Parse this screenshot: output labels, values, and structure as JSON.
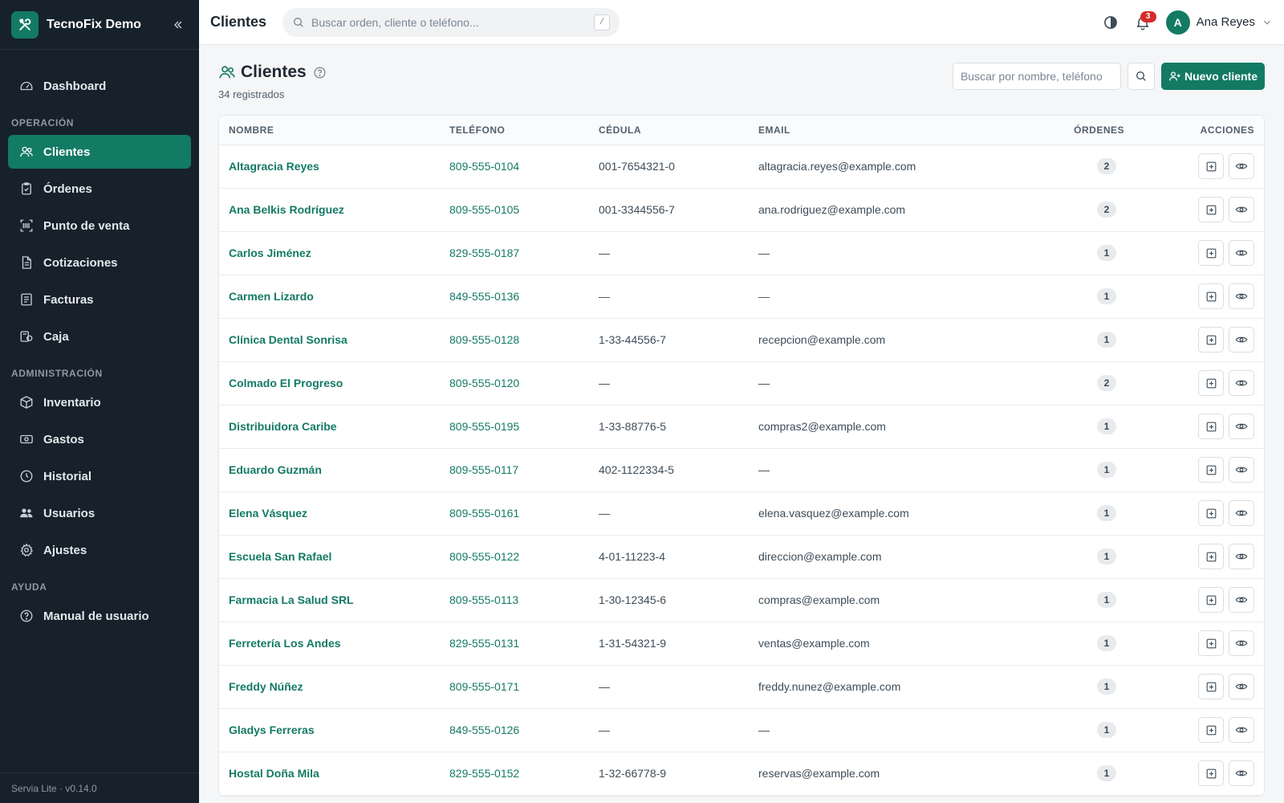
{
  "brand": {
    "name": "TecnoFix Demo"
  },
  "sidebar": {
    "items_top": [
      {
        "label": "Dashboard",
        "icon": "dashboard-icon"
      }
    ],
    "section_operacion": "OPERACIÓN",
    "items_operacion": [
      {
        "label": "Clientes",
        "icon": "users-icon",
        "active": true
      },
      {
        "label": "Órdenes",
        "icon": "clipboard-icon"
      },
      {
        "label": "Punto de venta",
        "icon": "scan-icon"
      },
      {
        "label": "Cotizaciones",
        "icon": "document-icon"
      },
      {
        "label": "Facturas",
        "icon": "receipt-icon"
      },
      {
        "label": "Caja",
        "icon": "cash-register-icon"
      }
    ],
    "section_admin": "ADMINISTRACIÓN",
    "items_admin": [
      {
        "label": "Inventario",
        "icon": "box-icon"
      },
      {
        "label": "Gastos",
        "icon": "money-icon"
      },
      {
        "label": "Historial",
        "icon": "clock-icon"
      },
      {
        "label": "Usuarios",
        "icon": "users-group-icon"
      },
      {
        "label": "Ajustes",
        "icon": "gear-icon"
      }
    ],
    "section_ayuda": "AYUDA",
    "items_ayuda": [
      {
        "label": "Manual de usuario",
        "icon": "help-circle-icon"
      }
    ],
    "footer": "Servia Lite · v0.14.0"
  },
  "topbar": {
    "title": "Clientes",
    "search_placeholder": "Buscar orden, cliente o teléfono...",
    "shortcut": "/",
    "notifications": "3",
    "user_initial": "A",
    "user_name": "Ana Reyes"
  },
  "page": {
    "title": "Clientes",
    "subtitle": "34 registrados",
    "search_placeholder": "Buscar por nombre, teléfono",
    "new_button": "Nuevo cliente"
  },
  "colors": {
    "accent": "#137a64",
    "sidebar": "#17212b",
    "badge": "#d62b2b"
  },
  "table": {
    "headers": [
      "NOMBRE",
      "TELÉFONO",
      "CÉDULA",
      "EMAIL",
      "ÓRDENES",
      "ACCIONES"
    ],
    "rows": [
      {
        "name": "Altagracia Reyes",
        "phone": "809-555-0104",
        "cedula": "001-7654321-0",
        "email": "altagracia.reyes@example.com",
        "orders": "2"
      },
      {
        "name": "Ana Belkis Rodríguez",
        "phone": "809-555-0105",
        "cedula": "001-3344556-7",
        "email": "ana.rodriguez@example.com",
        "orders": "2"
      },
      {
        "name": "Carlos Jiménez",
        "phone": "829-555-0187",
        "cedula": "—",
        "email": "—",
        "orders": "1"
      },
      {
        "name": "Carmen Lizardo",
        "phone": "849-555-0136",
        "cedula": "—",
        "email": "—",
        "orders": "1"
      },
      {
        "name": "Clínica Dental Sonrisa",
        "phone": "809-555-0128",
        "cedula": "1-33-44556-7",
        "email": "recepcion@example.com",
        "orders": "1"
      },
      {
        "name": "Colmado El Progreso",
        "phone": "809-555-0120",
        "cedula": "—",
        "email": "—",
        "orders": "2"
      },
      {
        "name": "Distribuidora Caribe",
        "phone": "809-555-0195",
        "cedula": "1-33-88776-5",
        "email": "compras2@example.com",
        "orders": "1"
      },
      {
        "name": "Eduardo Guzmán",
        "phone": "809-555-0117",
        "cedula": "402-1122334-5",
        "email": "—",
        "orders": "1"
      },
      {
        "name": "Elena Vásquez",
        "phone": "809-555-0161",
        "cedula": "—",
        "email": "elena.vasquez@example.com",
        "orders": "1"
      },
      {
        "name": "Escuela San Rafael",
        "phone": "809-555-0122",
        "cedula": "4-01-11223-4",
        "email": "direccion@example.com",
        "orders": "1"
      },
      {
        "name": "Farmacia La Salud SRL",
        "phone": "809-555-0113",
        "cedula": "1-30-12345-6",
        "email": "compras@example.com",
        "orders": "1"
      },
      {
        "name": "Ferretería Los Andes",
        "phone": "829-555-0131",
        "cedula": "1-31-54321-9",
        "email": "ventas@example.com",
        "orders": "1"
      },
      {
        "name": "Freddy Núñez",
        "phone": "809-555-0171",
        "cedula": "—",
        "email": "freddy.nunez@example.com",
        "orders": "1"
      },
      {
        "name": "Gladys Ferreras",
        "phone": "849-555-0126",
        "cedula": "—",
        "email": "—",
        "orders": "1"
      },
      {
        "name": "Hostal Doña Mila",
        "phone": "829-555-0152",
        "cedula": "1-32-66778-9",
        "email": "reservas@example.com",
        "orders": "1"
      }
    ]
  }
}
